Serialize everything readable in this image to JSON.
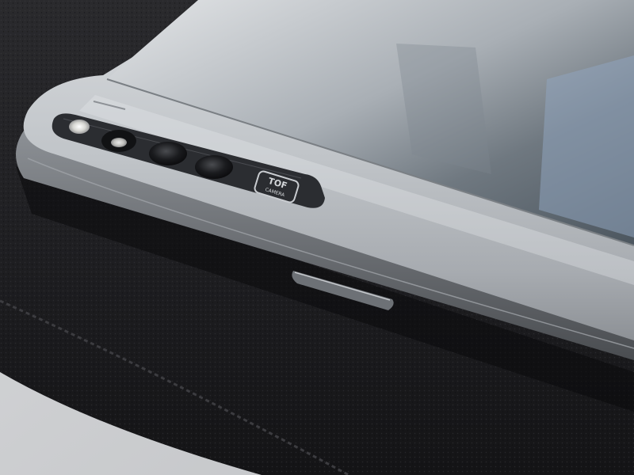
{
  "scene": {
    "subject": "foldable-phone-camera-side",
    "surface": "black-leather-pad",
    "background": "light-desk"
  },
  "camera_module": {
    "badge_line1": "TOF",
    "badge_line2": "CAMERA",
    "lens_count": 4,
    "flash_count": 1
  },
  "colors": {
    "leather": "#1c1c1e",
    "phone_body": "#b9bdc2",
    "camera_strip": "#2b2d31",
    "screen": "#9aa1a8",
    "stitch": "#3a3a3c"
  }
}
